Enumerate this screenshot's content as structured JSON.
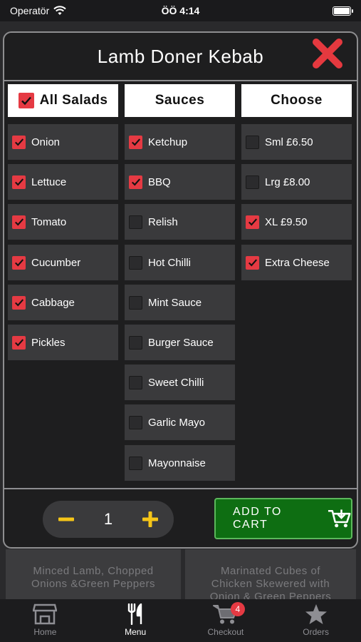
{
  "status_bar": {
    "carrier": "Operatör",
    "time": "ÖÖ 4:14"
  },
  "modal": {
    "title": "Lamb Doner Kebab",
    "salads": {
      "header": "All Salads",
      "header_checked": true,
      "items": [
        {
          "label": "Onion",
          "checked": true
        },
        {
          "label": "Lettuce",
          "checked": true
        },
        {
          "label": "Tomato",
          "checked": true
        },
        {
          "label": "Cucumber",
          "checked": true
        },
        {
          "label": "Cabbage",
          "checked": true
        },
        {
          "label": "Pickles",
          "checked": true
        }
      ]
    },
    "sauces": {
      "header": "Sauces",
      "items": [
        {
          "label": "Ketchup",
          "checked": true
        },
        {
          "label": "BBQ",
          "checked": true
        },
        {
          "label": "Relish",
          "checked": false
        },
        {
          "label": "Hot Chilli",
          "checked": false
        },
        {
          "label": "Mint Sauce",
          "checked": false
        },
        {
          "label": "Burger Sauce",
          "checked": false
        },
        {
          "label": "Sweet Chilli",
          "checked": false
        },
        {
          "label": "Garlic Mayo",
          "checked": false
        },
        {
          "label": "Mayonnaise",
          "checked": false
        }
      ]
    },
    "choose": {
      "header": "Choose",
      "items": [
        {
          "label": "Sml £6.50",
          "checked": false
        },
        {
          "label": "Lrg £8.00",
          "checked": false
        },
        {
          "label": "XL £9.50",
          "checked": true
        },
        {
          "label": "Extra Cheese",
          "checked": true
        }
      ]
    },
    "quantity": "1",
    "add_to_cart_label": "ADD TO CART"
  },
  "background_cards": [
    {
      "line1": "Minced Lamb, Chopped",
      "line2": "Onions &Green Peppers"
    },
    {
      "line1": "Marinated Cubes of",
      "line2": "Chicken Skewered with",
      "line3": "Onion & Green Peppers"
    }
  ],
  "tab_bar": {
    "tabs": [
      {
        "label": "Home",
        "icon": "shop-icon"
      },
      {
        "label": "Menu",
        "icon": "fork-knife-icon"
      },
      {
        "label": "Checkout",
        "icon": "cart-icon",
        "badge": "4"
      },
      {
        "label": "Orders",
        "icon": "star-icon"
      }
    ],
    "active": "Menu"
  },
  "colors": {
    "checkbox_checked": "#e53a43",
    "close_icon": "#e5393f",
    "add_to_cart_bg": "#0e6e12",
    "quantity_icons": "#f5c518"
  }
}
